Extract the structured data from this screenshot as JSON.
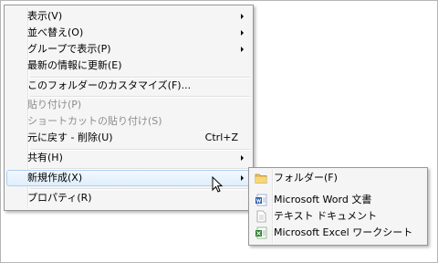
{
  "context_menu": {
    "items": [
      {
        "label": "表示(V)",
        "has_submenu": true
      },
      {
        "label": "並べ替え(O)",
        "has_submenu": true
      },
      {
        "label": "グループで表示(P)",
        "has_submenu": true
      },
      {
        "label": "最新の情報に更新(E)"
      },
      {
        "label": "このフォルダーのカスタマイズ(F)..."
      },
      {
        "label": "貼り付け(P)",
        "disabled": true
      },
      {
        "label": "ショートカットの貼り付け(S)",
        "disabled": true
      },
      {
        "label": "元に戻す - 削除(U)",
        "shortcut": "Ctrl+Z"
      },
      {
        "label": "共有(H)",
        "has_submenu": true
      },
      {
        "label": "新規作成(X)",
        "has_submenu": true,
        "highlighted": true
      },
      {
        "label": "プロパティ(R)"
      }
    ]
  },
  "new_submenu": {
    "items": [
      {
        "label": "フォルダー(F)",
        "icon": "folder-icon"
      },
      {
        "label": "Microsoft Word 文書",
        "icon": "word-document-icon"
      },
      {
        "label": "テキスト ドキュメント",
        "icon": "text-document-icon"
      },
      {
        "label": "Microsoft Excel ワークシート",
        "icon": "excel-worksheet-icon"
      }
    ]
  }
}
